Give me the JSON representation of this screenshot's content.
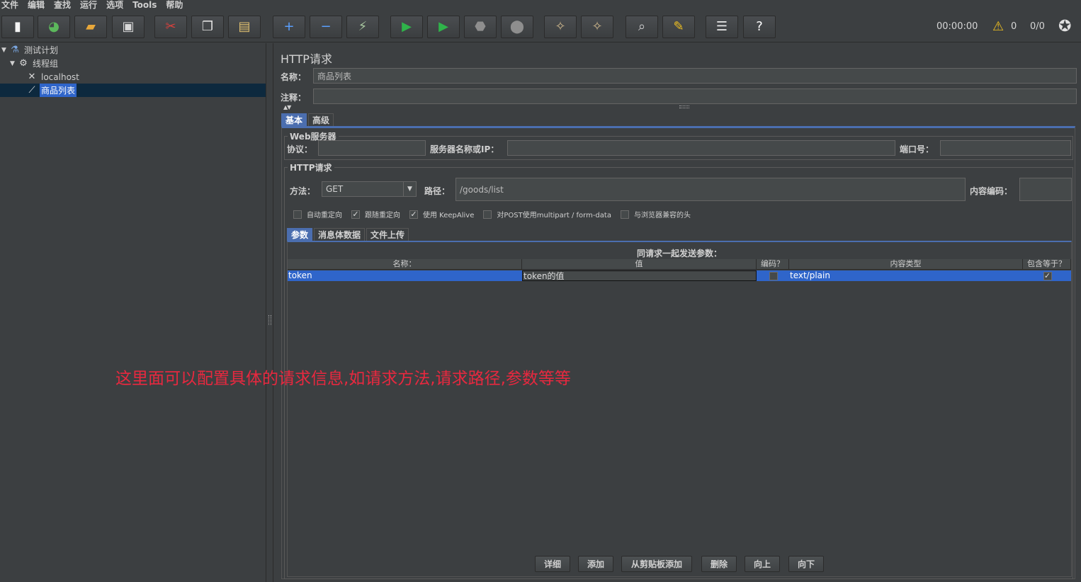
{
  "menu": [
    "文件",
    "编辑",
    "查找",
    "运行",
    "选项",
    "Tools",
    "帮助"
  ],
  "toolbar": {
    "buttons": [
      {
        "name": "new-icon",
        "glyph": "▮",
        "color": "#f4f4f4"
      },
      {
        "name": "templates-icon",
        "glyph": "◕",
        "color": "#5cb85c"
      },
      {
        "name": "open-icon",
        "glyph": "▰",
        "color": "#e8a83a"
      },
      {
        "name": "save-icon",
        "glyph": "▣",
        "color": "#d8d8d8"
      },
      {
        "name": "cut-icon",
        "glyph": "✂",
        "color": "#d9413d"
      },
      {
        "name": "copy-icon",
        "glyph": "❐",
        "color": "#e0e0e0"
      },
      {
        "name": "paste-icon",
        "glyph": "▤",
        "color": "#e0c070"
      },
      {
        "name": "expand-icon",
        "glyph": "+",
        "color": "#5aa0ff"
      },
      {
        "name": "collapse-icon",
        "glyph": "−",
        "color": "#5aa0ff"
      },
      {
        "name": "toggle-icon",
        "glyph": "⚡",
        "color": "#a8c8a0"
      },
      {
        "name": "start-icon",
        "glyph": "▶",
        "color": "#2fb34a"
      },
      {
        "name": "start-no-pause-icon",
        "glyph": "▶",
        "color": "#2fb34a"
      },
      {
        "name": "stop-icon",
        "glyph": "⬣",
        "color": "#8e8e8e"
      },
      {
        "name": "shutdown-icon",
        "glyph": "⬤",
        "color": "#8e8e8e"
      },
      {
        "name": "clear-icon",
        "glyph": "✧",
        "color": "#c9b38a"
      },
      {
        "name": "clear-all-icon",
        "glyph": "✧",
        "color": "#c9b38a"
      },
      {
        "name": "search-icon",
        "glyph": "⌕",
        "color": "#d0d0d0"
      },
      {
        "name": "reset-search-icon",
        "glyph": "✎",
        "color": "#f0c020"
      },
      {
        "name": "function-helper-icon",
        "glyph": "☰",
        "color": "#e8e8e8"
      },
      {
        "name": "help-icon",
        "glyph": "?",
        "color": "#ffffff"
      }
    ],
    "timer": "00:00:00",
    "warning_count": "0",
    "threads": "0/0"
  },
  "tree": [
    {
      "label": "测试计划",
      "icon": "flask-icon",
      "glyph": "⚗",
      "arrow": "▼",
      "indent": 0
    },
    {
      "label": "线程组",
      "icon": "gear-icon",
      "glyph": "⚙",
      "arrow": "▼",
      "indent": 1
    },
    {
      "label": "localhost",
      "icon": "config-icon",
      "glyph": "✕",
      "arrow": "",
      "indent": 2
    },
    {
      "label": "商品列表",
      "icon": "sampler-icon",
      "glyph": "⟋",
      "arrow": "",
      "indent": 2,
      "selected": true
    }
  ],
  "panel": {
    "title": "HTTP请求",
    "name_label": "名称：",
    "name_value": "商品列表",
    "comment_label": "注释：",
    "comment_value": ""
  },
  "tabs": [
    "基本",
    "高级"
  ],
  "web_server": {
    "title": "Web服务器",
    "protocol_label": "协议：",
    "protocol_value": "",
    "server_label": "服务器名称或IP：",
    "server_value": "",
    "port_label": "端口号：",
    "port_value": ""
  },
  "http_request": {
    "title": "HTTP请求",
    "method_label": "方法：",
    "method_value": "GET",
    "path_label": "路径：",
    "path_value": "/goods/list",
    "encoding_label": "内容编码：",
    "encoding_value": ""
  },
  "checkboxes": [
    {
      "label": "自动重定向",
      "checked": false
    },
    {
      "label": "跟随重定向",
      "checked": true
    },
    {
      "label": "使用 KeepAlive",
      "checked": true
    },
    {
      "label": "对POST使用multipart / form-data",
      "checked": false
    },
    {
      "label": "与浏览器兼容的头",
      "checked": false
    }
  ],
  "inner_tabs": [
    "参数",
    "消息体数据",
    "文件上传"
  ],
  "params": {
    "caption": "同请求一起发送参数：",
    "headers": [
      "名称：",
      "值",
      "编码？",
      "内容类型",
      "包含等于？"
    ],
    "rows": [
      {
        "name": "token",
        "value": "token的值",
        "encode": false,
        "content_type": "text/plain",
        "include_equals": true
      }
    ]
  },
  "bottom_buttons": [
    "详细",
    "添加",
    "从剪贴板添加",
    "删除",
    "向上",
    "向下"
  ],
  "annotation": "这里面可以配置具体的请求信息,如请求方法,请求路径,参数等等"
}
